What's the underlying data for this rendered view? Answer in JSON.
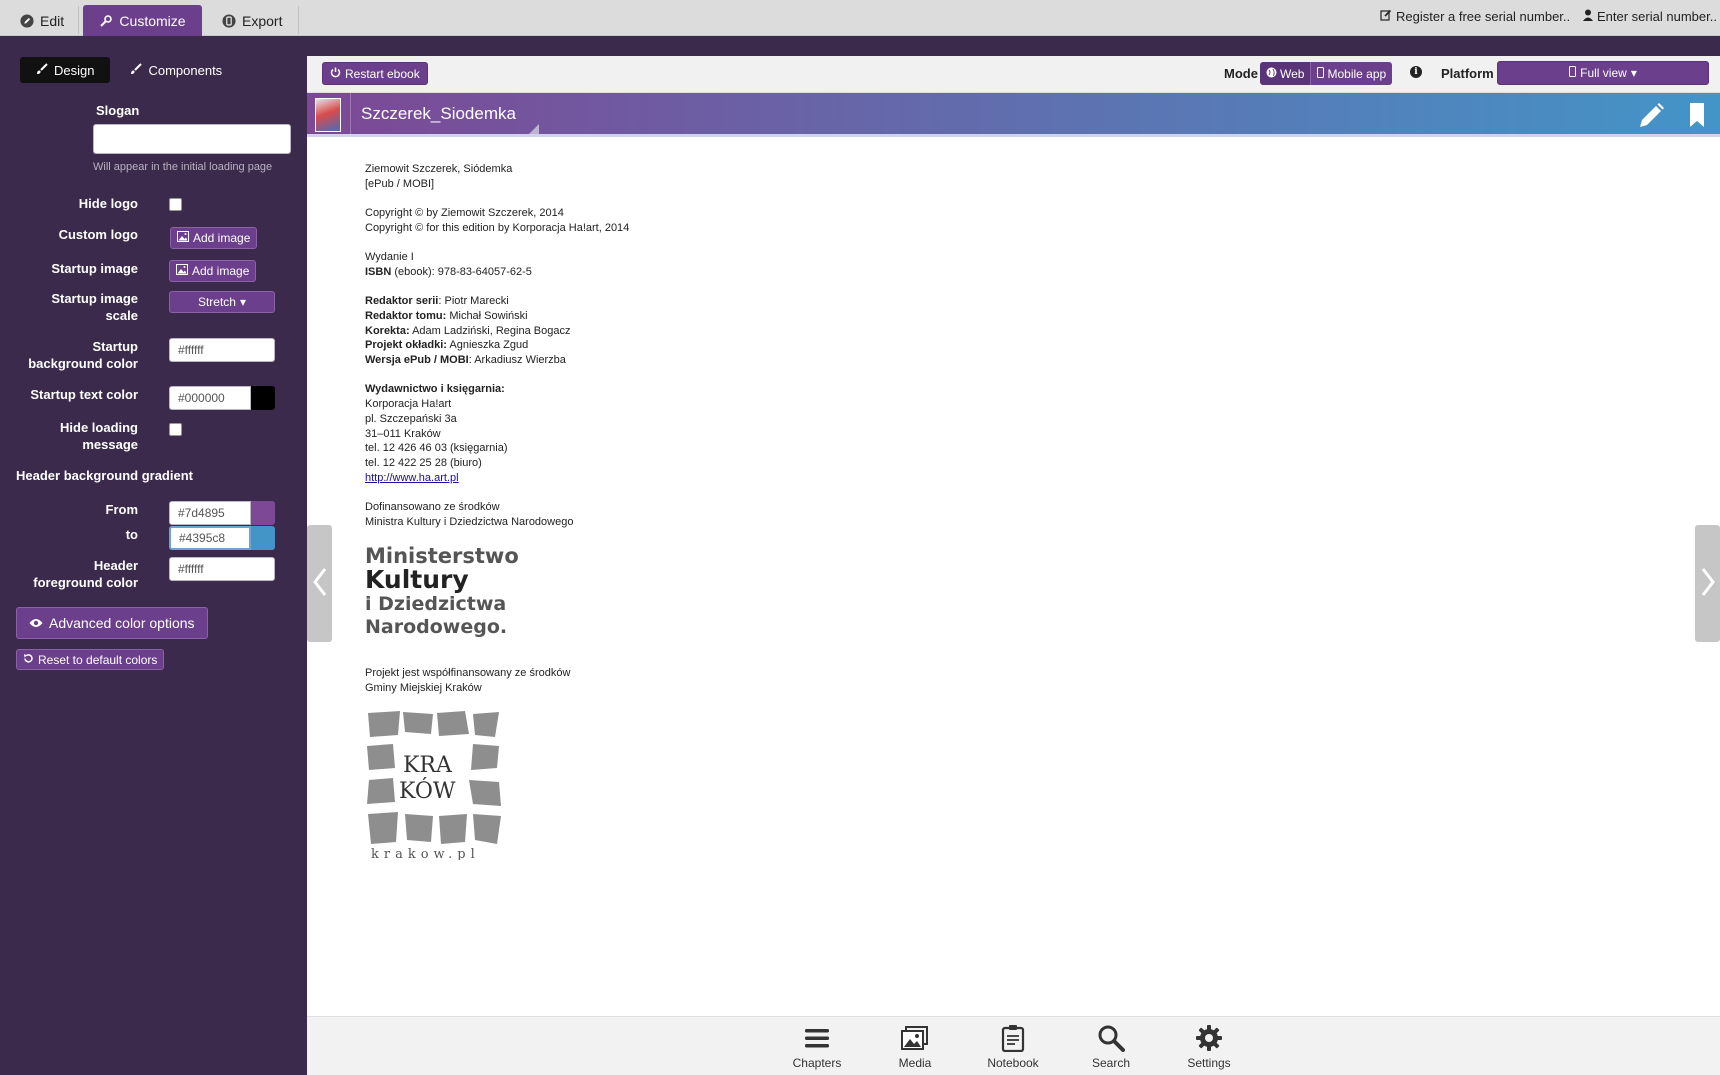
{
  "topbar": {
    "tabs": [
      {
        "label": "Edit",
        "icon": "pencil-icon"
      },
      {
        "label": "Customize",
        "icon": "wrench-icon",
        "active": true
      },
      {
        "label": "Export",
        "icon": "device-icon"
      }
    ],
    "register_link": "Register a free serial number..",
    "enter_serial_link": "Enter serial number.."
  },
  "sidebar": {
    "tabs": [
      {
        "label": "Design",
        "icon": "brush-icon",
        "active": true
      },
      {
        "label": "Components",
        "icon": "puzzle-icon"
      }
    ],
    "slogan": {
      "label": "Slogan",
      "value": "",
      "hint": "Will appear in the initial loading page"
    },
    "hide_logo": {
      "label": "Hide logo",
      "checked": false
    },
    "custom_logo": {
      "label": "Custom logo",
      "button": "Add image"
    },
    "startup_image": {
      "label": "Startup image",
      "button": "Add image"
    },
    "startup_image_scale": {
      "label_line1": "Startup image",
      "label_line2": "scale",
      "value": "Stretch"
    },
    "startup_bg_color": {
      "label_line1": "Startup",
      "label_line2": "background color",
      "value": "#ffffff"
    },
    "startup_text_color": {
      "label": "Startup text color",
      "value": "#000000",
      "swatch": "#000000"
    },
    "hide_loading": {
      "label_line1": "Hide loading",
      "label_line2": "message",
      "checked": false
    },
    "gradient": {
      "title": "Header background gradient",
      "from_label": "From",
      "from_value": "#7d4895",
      "to_label": "to",
      "to_value": "#4395c8"
    },
    "header_fg": {
      "label_line1": "Header",
      "label_line2": "foreground color",
      "value": "#ffffff"
    },
    "advanced_button": "Advanced color options",
    "reset_button": "Reset to default colors"
  },
  "preview_toolbar": {
    "restart_button": "Restart ebook",
    "mode_label": "Mode",
    "mode_options": [
      {
        "label": "Web",
        "icon": "globe-icon",
        "active": true
      },
      {
        "label": "Mobile app",
        "icon": "mobile-icon",
        "active": false
      }
    ],
    "platform_label": "Platform",
    "platform_value": "Full view"
  },
  "ebook": {
    "title": "Szczerek_Siodemka",
    "content": {
      "line1": "Ziemowit Szczerek, Siódemka",
      "line2": "[ePub / MOBI]",
      "copy1": "Copyright © by Ziemowit Szczerek, 2014",
      "copy2": "Copyright © for this edition by Korporacja Ha!art, 2014",
      "edition": "Wydanie I",
      "isbn_label": "ISBN",
      "isbn_value": " (ebook): 978-83-64057-62-5",
      "credits": [
        {
          "label": "Redaktor serii",
          "value": ": Piotr Marecki"
        },
        {
          "label": "Redaktor tomu:",
          "value": " Michał Sowiński"
        },
        {
          "label": "Korekta:",
          "value": " Adam Ladziński, Regina Bogacz"
        },
        {
          "label": "Projekt okładki:",
          "value": " Agnieszka Zgud"
        },
        {
          "label": "Wersja ePub / MOBI",
          "value": ": Arkadiusz Wierzba"
        }
      ],
      "publisher_heading": "Wydawnictwo i księgarnia:",
      "publisher_lines": [
        "Korporacja Ha!art",
        "pl. Szczepański 3a",
        "31–011 Kraków",
        "tel. 12 426 46 03 (księgarnia)",
        "tel. 12 422 25 28 (biuro)"
      ],
      "url": "http://www.ha.art.pl",
      "funding1": "Dofinansowano ze środków",
      "funding2": "Ministra Kultury i Dziedzictwa Narodowego",
      "ministry_logo_lines": [
        "Ministerstwo",
        "Kultury",
        "i Dziedzictwa",
        "Narodowego."
      ],
      "cofund1": "Projekt jest współfinansowany ze środków",
      "cofund2": "Gminy Miejskiej Kraków",
      "krakow_logo_text1": "KRA",
      "krakow_logo_text2": "KÓW",
      "krakow_logo_url": "krakow.pl"
    }
  },
  "bottom_nav": [
    {
      "label": "Chapters",
      "icon": "menu-icon"
    },
    {
      "label": "Media",
      "icon": "images-icon"
    },
    {
      "label": "Notebook",
      "icon": "clipboard-icon"
    },
    {
      "label": "Search",
      "icon": "search-icon"
    },
    {
      "label": "Settings",
      "icon": "gear-icon"
    }
  ],
  "colors": {
    "accent": "#6c3f8c",
    "sidebar_bg": "#3b2a4b",
    "gradient_from": "#7d4895",
    "gradient_to": "#4395c8"
  }
}
